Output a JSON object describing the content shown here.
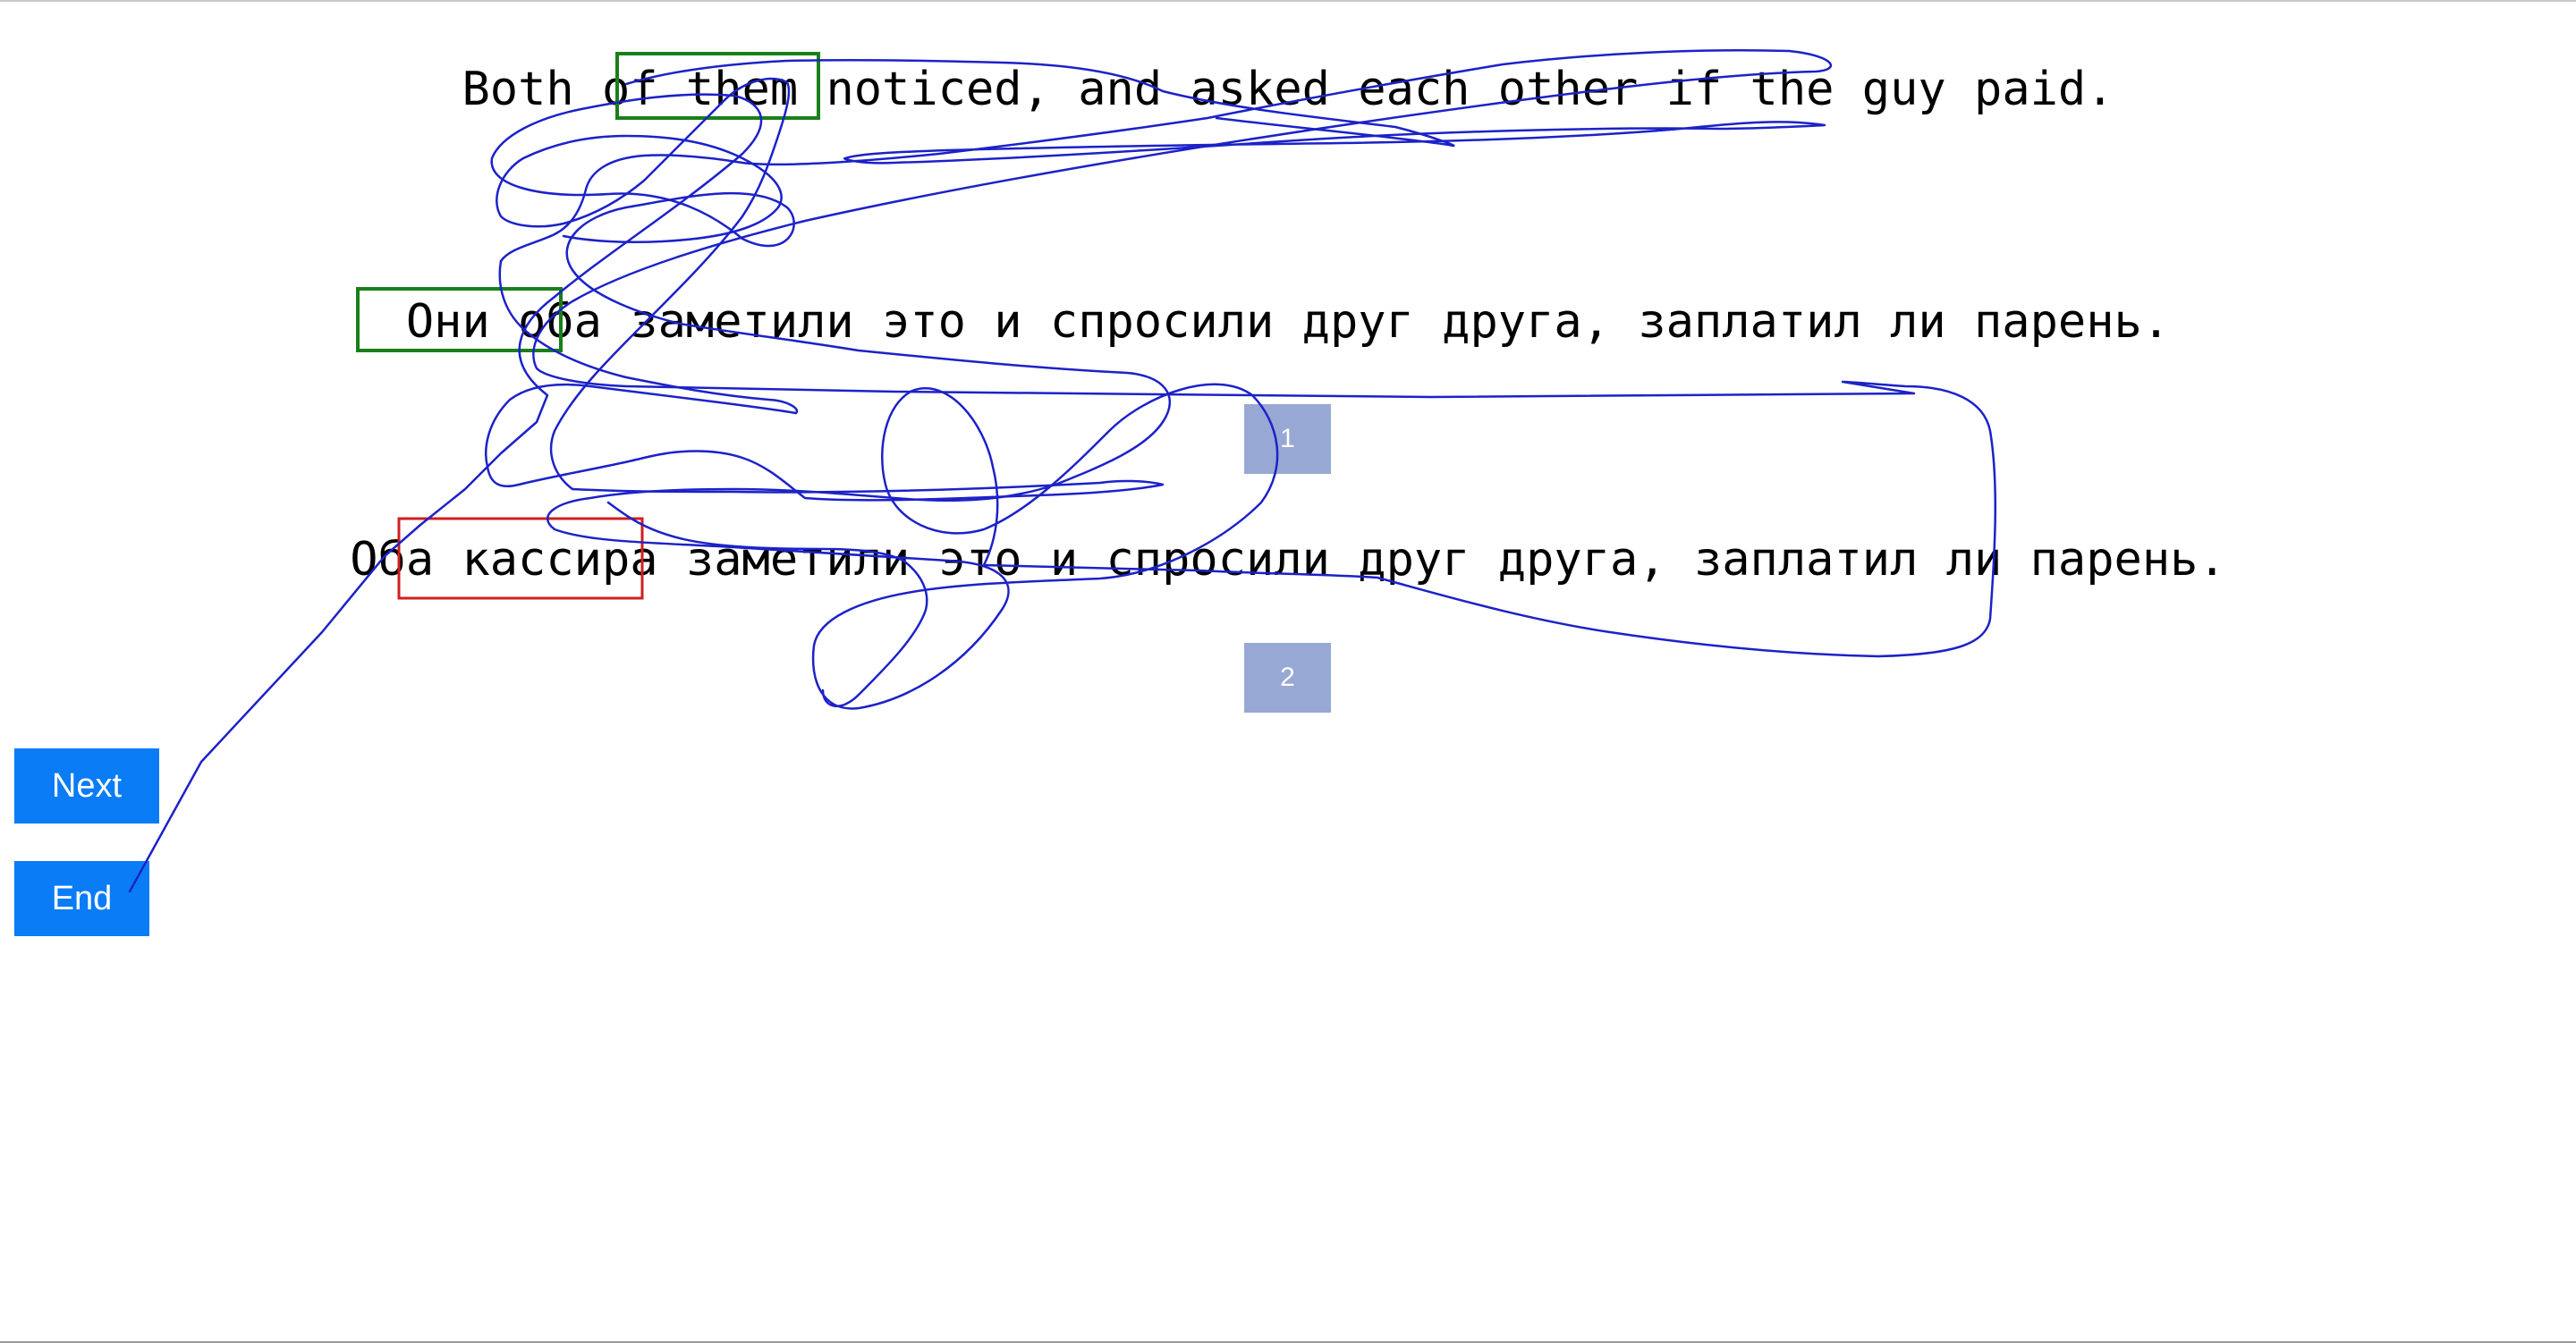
{
  "sentences": {
    "source": "Both of them noticed, and asked each other if the guy paid.",
    "reference": "Они оба заметили это и спросили друг друга, заплатил ли парень.",
    "translation": "Оба кассира заметили это и спросили друг друга, заплатил ли парень."
  },
  "scores": {
    "first": "1",
    "second": "2"
  },
  "buttons": {
    "next": "Next",
    "end": "End"
  },
  "colors": {
    "score_box": "#97a8d4",
    "button": "#0a7cf5",
    "highlight_correct": "#1a7f1a",
    "highlight_error": "#d01f1f",
    "gaze_trace": "#1c22c8"
  }
}
